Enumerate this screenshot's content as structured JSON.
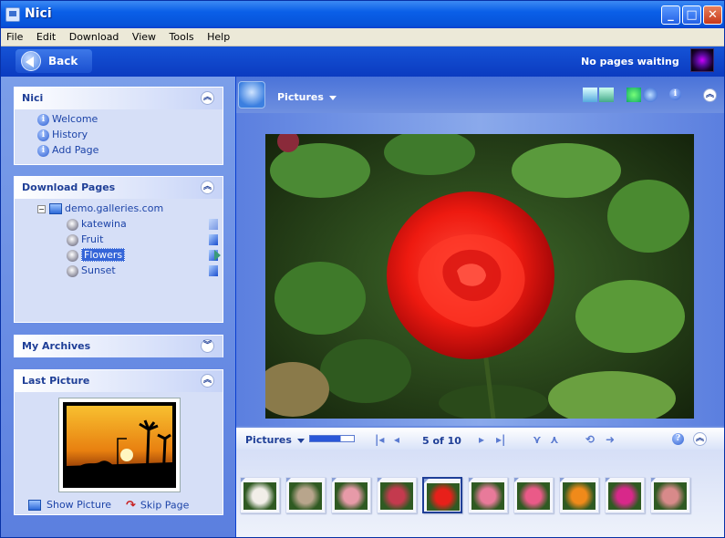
{
  "window": {
    "title": "Nici"
  },
  "menu": [
    {
      "label": "File"
    },
    {
      "label": "Edit"
    },
    {
      "label": "Download"
    },
    {
      "label": "View"
    },
    {
      "label": "Tools"
    },
    {
      "label": "Help"
    }
  ],
  "nav": {
    "back_label": "Back",
    "status": "No pages waiting"
  },
  "panels": {
    "nici": {
      "title": "Nici",
      "items": [
        {
          "label": "Welcome"
        },
        {
          "label": "History"
        },
        {
          "label": "Add Page"
        }
      ]
    },
    "download": {
      "title": "Download Pages",
      "root": "demo.galleries.com",
      "items": [
        {
          "label": "katewina"
        },
        {
          "label": "Fruit"
        },
        {
          "label": "Flowers",
          "selected": true
        },
        {
          "label": "Sunset"
        }
      ]
    },
    "archives": {
      "title": "My Archives"
    },
    "last_picture": {
      "title": "Last Picture",
      "show_label": "Show Picture",
      "skip_label": "Skip Page"
    }
  },
  "main": {
    "title": "Pictures",
    "filmstrip": {
      "title": "Pictures",
      "counter": "5 of 10",
      "zoom_fraction": 0.7,
      "selected_index": 4,
      "thumbs": [
        {
          "name": "white-rose",
          "color": "#f2eee8"
        },
        {
          "name": "spiral",
          "color": "#b8a58c"
        },
        {
          "name": "pink-rose-wood",
          "color": "#e79aa8"
        },
        {
          "name": "red-pink-rose",
          "color": "#c43a4e"
        },
        {
          "name": "red-rose",
          "color": "#e8201a"
        },
        {
          "name": "pink-rose-green",
          "color": "#e87a9a"
        },
        {
          "name": "pink-rose",
          "color": "#ea5a88"
        },
        {
          "name": "tulip",
          "color": "#f08a1a"
        },
        {
          "name": "lily",
          "color": "#d8288a"
        },
        {
          "name": "rose-wood",
          "color": "#d88a8a"
        }
      ]
    }
  }
}
